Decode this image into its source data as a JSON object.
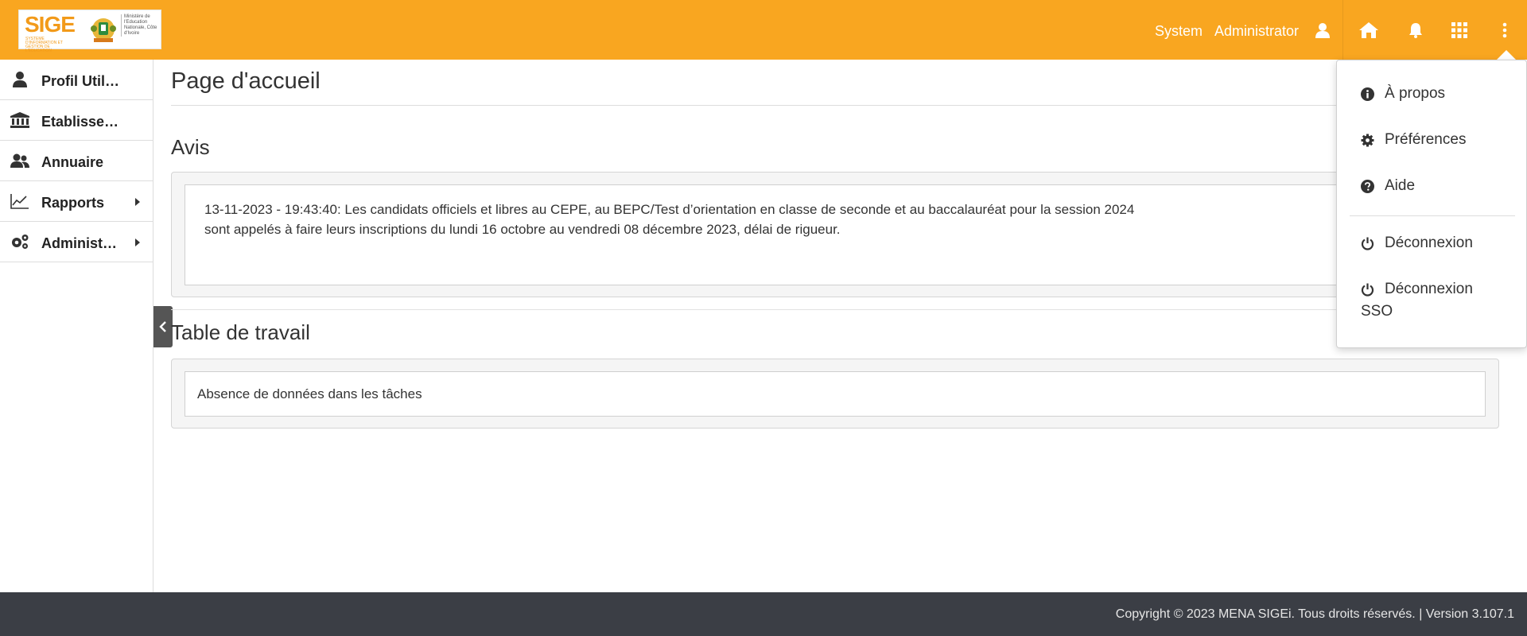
{
  "logo": {
    "brand": "SIGE",
    "brand_sub": "SYSTEME D'INFORMATION ET GESTION DE L'EDUCATION",
    "ministry": "Ministère de l'Education Nationale, Côte d'Ivoire"
  },
  "header": {
    "user_first": "System",
    "user_last": "Administrator",
    "icons": [
      "user-icon",
      "home-icon",
      "bell-icon",
      "apps-grid-icon",
      "more-vertical-icon"
    ],
    "accent_color": "#f9a620"
  },
  "sidebar": {
    "items": [
      {
        "label": "Profil Util…",
        "icon": "user-icon",
        "has_submenu": false
      },
      {
        "label": "Etablisse…",
        "icon": "bank-icon",
        "has_submenu": false
      },
      {
        "label": "Annuaire",
        "icon": "users-icon",
        "has_submenu": false
      },
      {
        "label": "Rapports",
        "icon": "line-chart-icon",
        "has_submenu": true
      },
      {
        "label": "Administ…",
        "icon": "cogs-icon",
        "has_submenu": true
      }
    ]
  },
  "main": {
    "page_title": "Page d'accueil",
    "notices": {
      "title": "Avis",
      "text_line1": "13-11-2023 - 19:43:40: Les candidats officiels et libres au CEPE, au BEPC/Test d’orientation en classe de seconde et au baccalauréat pour la session 2024",
      "text_line2": "sont appelés à faire leurs inscriptions du lundi 16 octobre au vendredi 08 décembre 2023, délai de rigueur."
    },
    "worktable": {
      "title": "Table de travail",
      "empty_text": "Absence de données dans les tâches"
    }
  },
  "dropdown": {
    "about": "À propos",
    "preferences": "Préférences",
    "help": "Aide",
    "logout": "Déconnexion",
    "logout_sso_line1": "Déconnexion",
    "logout_sso_line2": "SSO"
  },
  "footer": {
    "text": "Copyright © 2023 MENA SIGEi. Tous droits réservés. | Version 3.107.1",
    "background": "#3b3e45"
  }
}
